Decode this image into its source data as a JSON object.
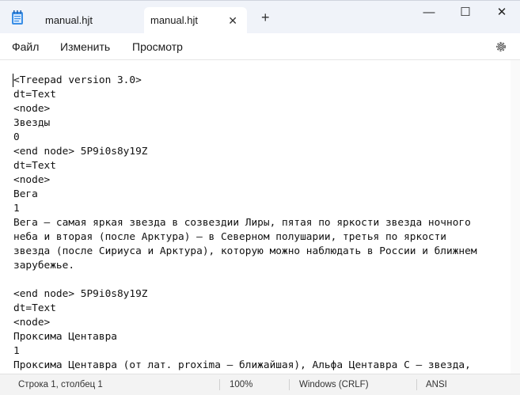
{
  "tabs": [
    {
      "label": "manual.hjt",
      "active": false
    },
    {
      "label": "manual.hjt",
      "active": true
    }
  ],
  "titlebar": {
    "new_tab": "+",
    "minimize": "—",
    "maximize": "☐",
    "close": "✕",
    "tab_close": "✕"
  },
  "menu": {
    "file": "Файл",
    "edit": "Изменить",
    "view": "Просмотр"
  },
  "editor": {
    "content": "<Treepad version 3.0>\ndt=Text\n<node>\nЗвезды\n0\n<end node> 5P9i0s8y19Z\ndt=Text\n<node>\nВега\n1\nВега — самая яркая звезда в созвездии Лиры, пятая по яркости звезда ночного\nнеба и вторая (после Арктура) — в Северном полушарии, третья по яркости\nзвезда (после Сириуса и Арктура), которую можно наблюдать в России и ближнем\nзарубежье.\n\n<end node> 5P9i0s8y19Z\ndt=Text\n<node>\nПроксима Центавра\n1\nПроксима Центавра (от лат. proxima — ближайшая), Альфа Центавра С — звезда,"
  },
  "status": {
    "position": "Строка 1, столбец 1",
    "zoom": "100%",
    "line_ending": "Windows (CRLF)",
    "encoding": "ANSI"
  }
}
